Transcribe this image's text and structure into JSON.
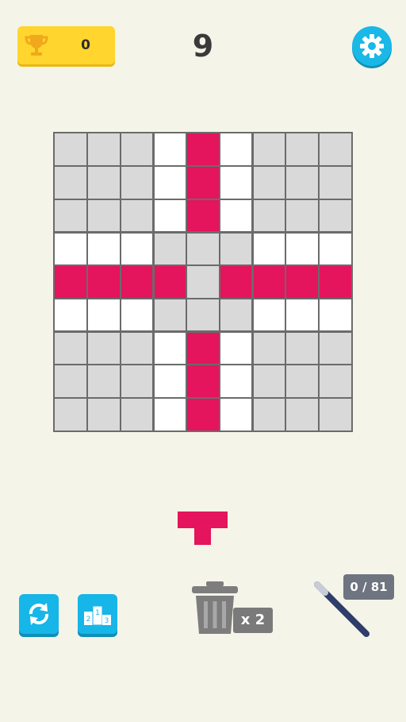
{
  "header": {
    "best_score": "0",
    "current_score": "9"
  },
  "icons": {
    "trophy": "trophy-icon",
    "settings": "gear-icon",
    "restart": "refresh-icon",
    "leaderboard": "podium-icon",
    "trash": "trash-icon",
    "wand": "magic-wand-icon"
  },
  "colors": {
    "background": "#f4f4e8",
    "filled": "#e4145d",
    "highlight": "#ffffff",
    "empty": "#d9d9d9",
    "gridline": "#6b6b6b",
    "accent": "#16b6e8",
    "trophy_bg": "#ffd52e"
  },
  "board": {
    "size": 9,
    "rows": [
      "eeewfweee",
      "eeewfweee",
      "eeewfweee",
      "wwweeewww",
      "ffffeffff",
      "wwweeewww",
      "eeewfweee",
      "eeewfweee",
      "eeewfweee"
    ]
  },
  "tray": {
    "piece_shape": [
      "###",
      ".#."
    ]
  },
  "tools": {
    "trash_count": "x 2",
    "wand_progress": "0 / 81"
  },
  "podium": {
    "place1": "1",
    "place2": "2",
    "place3": "3"
  }
}
